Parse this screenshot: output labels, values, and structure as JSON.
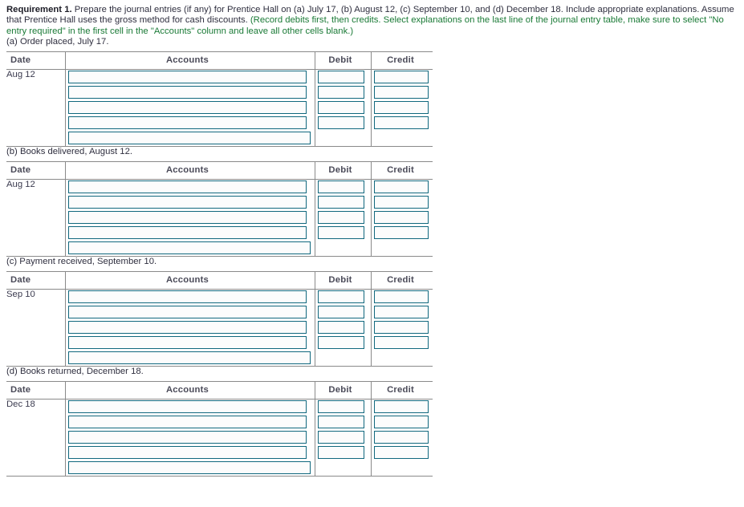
{
  "requirement": {
    "label": "Requirement 1.",
    "main": " Prepare the journal entries (if any) for Prentice Hall on (a) July 17, (b) August 12, (c) September 10, and (d) December 18. Include appropriate explanations. Assume that Prentice Hall uses the gross method for cash discounts. ",
    "hint": "(Record debits first, then credits. Select explanations on the last line of the journal entry table, make sure to select \"No entry required\" in the first cell in the \"Accounts\" column and leave all other cells blank.)"
  },
  "colors": {
    "input_border": "#11687e",
    "rule": "#8a8a8a",
    "hint_text": "#1a7a36",
    "body_text": "#2f2f3f"
  },
  "table_headers": {
    "date": "Date",
    "accounts": "Accounts",
    "debit": "Debit",
    "credit": "Credit"
  },
  "parts": [
    {
      "id": "a",
      "caption": "(a) Order placed, July 17.",
      "date": "Aug 12",
      "rows": [
        {
          "accounts": "",
          "debit": "",
          "credit": "",
          "has_amounts": true
        },
        {
          "accounts": "",
          "debit": "",
          "credit": "",
          "has_amounts": true
        },
        {
          "accounts": "",
          "debit": "",
          "credit": "",
          "has_amounts": true
        },
        {
          "accounts": "",
          "debit": "",
          "credit": "",
          "has_amounts": true
        },
        {
          "accounts": "",
          "debit": "",
          "credit": "",
          "has_amounts": false
        }
      ]
    },
    {
      "id": "b",
      "caption": "(b) Books delivered, August 12.",
      "date": "Aug 12",
      "rows": [
        {
          "accounts": "",
          "debit": "",
          "credit": "",
          "has_amounts": true
        },
        {
          "accounts": "",
          "debit": "",
          "credit": "",
          "has_amounts": true
        },
        {
          "accounts": "",
          "debit": "",
          "credit": "",
          "has_amounts": true
        },
        {
          "accounts": "",
          "debit": "",
          "credit": "",
          "has_amounts": true
        },
        {
          "accounts": "",
          "debit": "",
          "credit": "",
          "has_amounts": false
        }
      ]
    },
    {
      "id": "c",
      "caption": "(c) Payment received, September 10.",
      "date": "Sep 10",
      "rows": [
        {
          "accounts": "",
          "debit": "",
          "credit": "",
          "has_amounts": true
        },
        {
          "accounts": "",
          "debit": "",
          "credit": "",
          "has_amounts": true
        },
        {
          "accounts": "",
          "debit": "",
          "credit": "",
          "has_amounts": true
        },
        {
          "accounts": "",
          "debit": "",
          "credit": "",
          "has_amounts": true
        },
        {
          "accounts": "",
          "debit": "",
          "credit": "",
          "has_amounts": false
        }
      ]
    },
    {
      "id": "d",
      "caption": "(d) Books returned, December 18.",
      "date": "Dec 18",
      "rows": [
        {
          "accounts": "",
          "debit": "",
          "credit": "",
          "has_amounts": true
        },
        {
          "accounts": "",
          "debit": "",
          "credit": "",
          "has_amounts": true
        },
        {
          "accounts": "",
          "debit": "",
          "credit": "",
          "has_amounts": true
        },
        {
          "accounts": "",
          "debit": "",
          "credit": "",
          "has_amounts": true
        },
        {
          "accounts": "",
          "debit": "",
          "credit": "",
          "has_amounts": false
        }
      ]
    }
  ]
}
